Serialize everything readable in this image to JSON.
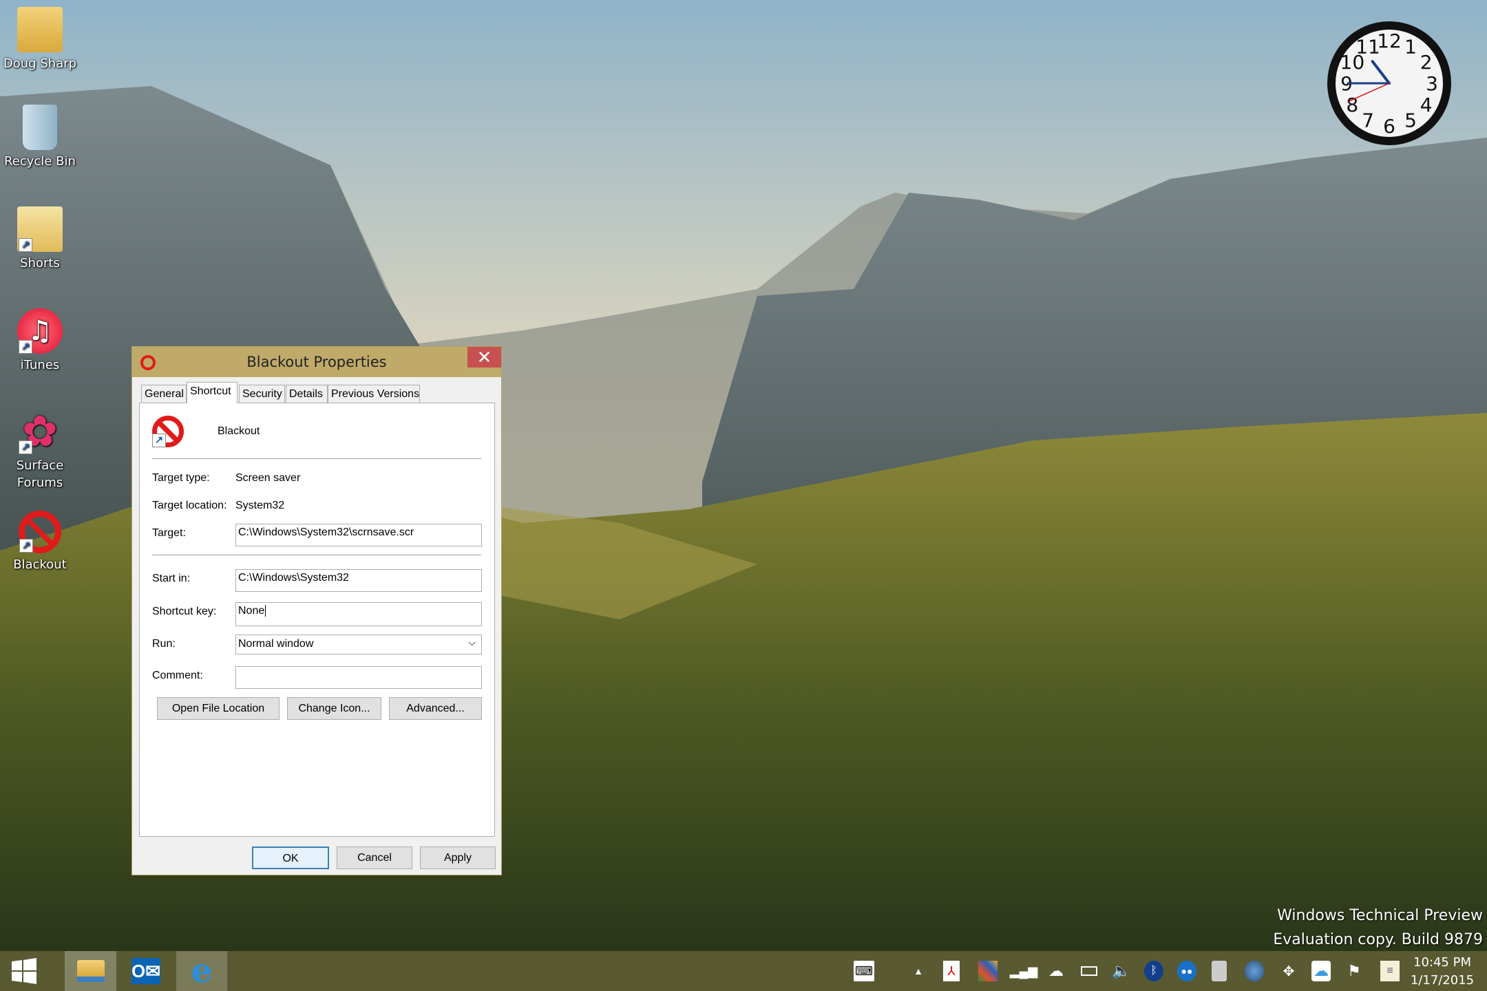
{
  "desktop": {
    "icons": [
      {
        "label": "Doug Sharp",
        "icon": "user-folder-icon"
      },
      {
        "label": "Recycle Bin",
        "icon": "recycle-bin-icon"
      },
      {
        "label": "Shorts",
        "icon": "shortcut-folder-icon"
      },
      {
        "label": "iTunes",
        "icon": "itunes-icon"
      },
      {
        "label": "Surface Forums",
        "icon": "surface-forums-icon"
      },
      {
        "label": "Blackout",
        "icon": "no-symbol-icon"
      }
    ],
    "clock_numbers": [
      "12",
      "1",
      "2",
      "3",
      "4",
      "5",
      "6",
      "7",
      "8",
      "9",
      "10",
      "11"
    ],
    "clock_time": {
      "hour": 10,
      "minute": 45,
      "second": 41
    },
    "watermark": {
      "line1": "Windows Technical Preview",
      "line2": "Evaluation copy. Build 9879"
    }
  },
  "dialog": {
    "title": "Blackout Properties",
    "close": "✕",
    "tabs": [
      {
        "label": "General"
      },
      {
        "label": "Shortcut",
        "active": true
      },
      {
        "label": "Security"
      },
      {
        "label": "Details"
      },
      {
        "label": "Previous Versions"
      }
    ],
    "name": "Blackout",
    "fields": {
      "target_type_label": "Target type:",
      "target_type": "Screen saver",
      "target_location_label": "Target location:",
      "target_location": "System32",
      "target_label": "Target:",
      "target": "C:\\Windows\\System32\\scrnsave.scr",
      "start_in_label": "Start in:",
      "start_in": "C:\\Windows\\System32",
      "shortcut_key_label": "Shortcut key:",
      "shortcut_key": "None",
      "run_label": "Run:",
      "run": "Normal window",
      "comment_label": "Comment:",
      "comment": ""
    },
    "buttons": {
      "open_file_location": "Open File Location",
      "change_icon": "Change Icon...",
      "advanced": "Advanced...",
      "ok": "OK",
      "cancel": "Cancel",
      "apply": "Apply"
    }
  },
  "taskbar": {
    "pinned": [
      "start-icon",
      "file-explorer-icon",
      "outlook-icon",
      "internet-explorer-icon"
    ],
    "tray": [
      "keyboard-icon",
      "show-hidden-icons",
      "acrobat-icon",
      "avg-icon",
      "network-signal-icon",
      "onedrive-icon",
      "battery-icon",
      "volume-icon",
      "bluetooth-icon",
      "remote-icon",
      "usb-drive-icon",
      "globe-icon",
      "dropbox-icon",
      "cloud-icon",
      "action-center-flag-icon",
      "notification-icon"
    ],
    "time": "10:45 PM",
    "date": "1/17/2015"
  },
  "colors": {
    "title_bar": "#bfaa6a",
    "close": "#c75050",
    "taskbar": "#6e693c"
  }
}
